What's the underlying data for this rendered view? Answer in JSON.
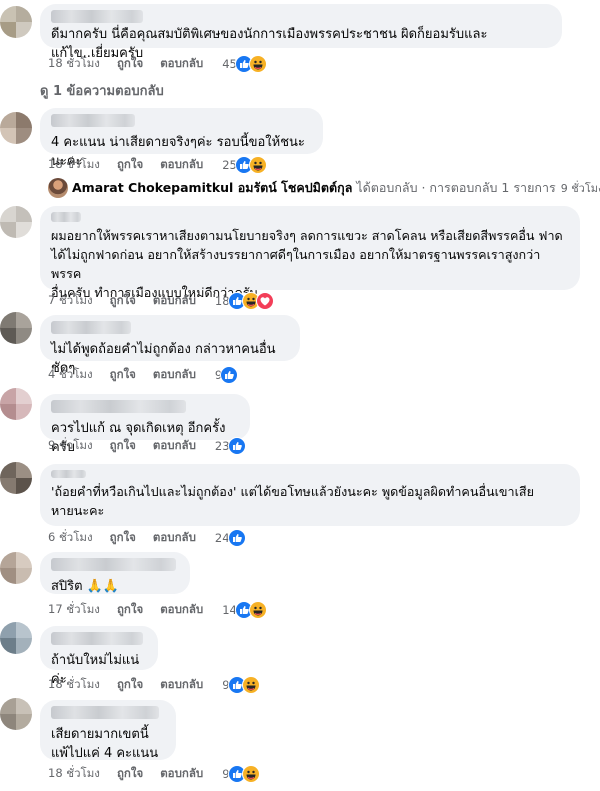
{
  "actions": {
    "like": "ถูกใจ",
    "reply": "ตอบกลับ"
  },
  "colors": {
    "like": "#1877f2",
    "haha": "#f7b125",
    "love": "#f33e58",
    "bubble": "#f0f2f5",
    "meta": "#65676b"
  },
  "comments": [
    {
      "text": "ดีมากครับ นี่คือคุณสมบัติพิเศษของนักการเมืองพรรคประชาชน ผิดก็ยอมรับและแก้ไข..เยี่ยมครับ",
      "time": "18 ชั่วโมง",
      "reaction_count": "45",
      "reactions": [
        "like",
        "haha"
      ]
    },
    {
      "text": "4 คะแนน น่าเสียดายจริงๆค่ะ รอบนี้ขอให้ชนะนะคะ",
      "time": "18 ชั่วโมง",
      "reaction_count": "25",
      "reactions": [
        "like",
        "haha"
      ]
    },
    {
      "text": "ผมอยากให้พรรคเราหาเสียงตามนโยบายจริงๆ ลดการแขวะ สาดโคลน หรือเสียดสีพรรคอื่น ฟาด\nได้ไม่ถูกฟาดก่อน อยากให้สร้างบรรยากาศดีๆในการเมือง อยากให้มาตรฐานพรรคเราสูงกว่าพรรค\nอื่นครับ ทำการเมืองแบบใหม่ดีกว่าครับ",
      "time": "7 ชั่วโมง",
      "reaction_count": "18",
      "reactions": [
        "like",
        "haha",
        "love"
      ]
    },
    {
      "text": "ไม่ได้พูดถ้อยคำไม่ถูกต้อง กล่าวหาคนอื่นชัดๆ",
      "time": "4 ชั่วโมง",
      "reaction_count": "9",
      "reactions": [
        "like"
      ]
    },
    {
      "text": "ควรไปแก้ ณ จุดเกิดเหตุ อีกครั้งครับ",
      "time": "9 ชั่วโมง",
      "reaction_count": "23",
      "reactions": [
        "like"
      ]
    },
    {
      "text": "'ถ้อยคำที่หวือเกินไปและไม่ถูกต้อง' แต่ได้ขอโทษแล้วยังนะคะ พูดข้อมูลผิดทำคนอื่นเขาเสีย\nหายนะคะ",
      "time": "6 ชั่วโมง",
      "reaction_count": "24",
      "reactions": [
        "like"
      ]
    },
    {
      "text": "สปิริต 🙏🙏",
      "time": "17 ชั่วโมง",
      "reaction_count": "14",
      "reactions": [
        "like",
        "haha"
      ]
    },
    {
      "text": "ถ้านับใหม่ไม่แน่ค่ะ",
      "time": "18 ชั่วโมง",
      "reaction_count": "9",
      "reactions": [
        "like",
        "haha"
      ]
    },
    {
      "text": "เสียดายมากเขตนี้\nแพ้ไปแค่ 4 คะแนน",
      "time": "18 ชั่วโมง",
      "reaction_count": "9",
      "reactions": [
        "like",
        "haha"
      ]
    }
  ],
  "view_replies": "ดู 1 ข้อความตอบกลับ",
  "reply_summary": {
    "name": "Amarat Chokepamitkul อมรัตน์ โชคปมิตต์กุล",
    "text": "ได้ตอบกลับ · การตอบกลับ 1 รายการ",
    "time": "9 ชั่วโมง"
  }
}
